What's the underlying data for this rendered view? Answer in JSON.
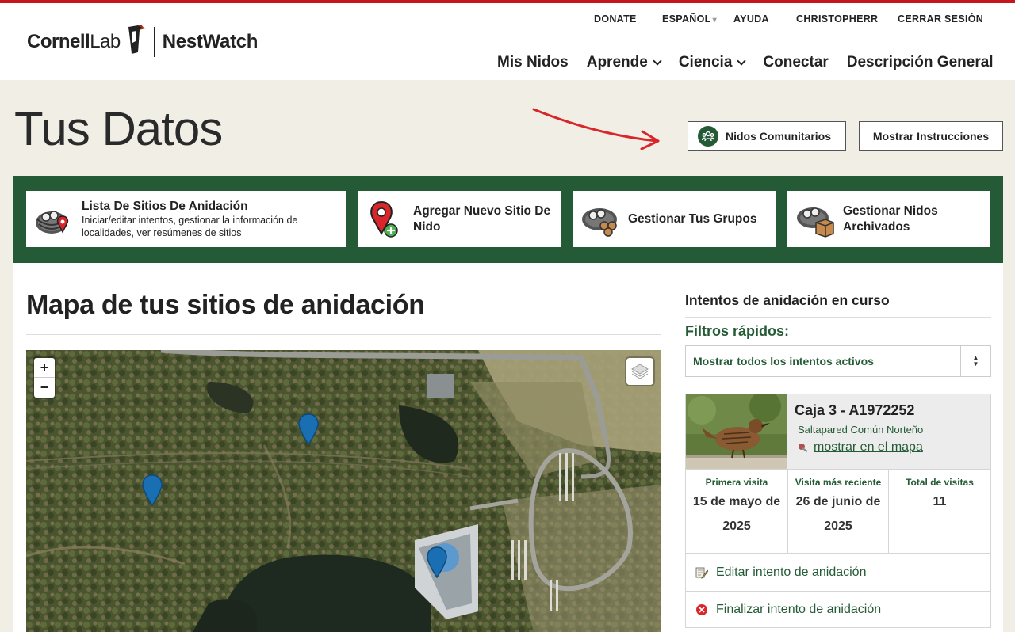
{
  "header": {
    "logo": {
      "brand": "Cornell",
      "brand_suffix": "Lab",
      "product": "NestWatch"
    },
    "utility_nav": {
      "donate": "DONATE",
      "language": "ESPAÑOL",
      "help": "AYUDA",
      "user": "CHRISTOPHERR",
      "logout": "CERRAR SESIÓN"
    },
    "main_nav": {
      "my_nests": "Mis Nidos",
      "learn": "Aprende",
      "science": "Ciencia",
      "connect": "Conectar",
      "overview": "Descripción General"
    }
  },
  "page": {
    "title": "Tus Datos",
    "community_button": "Nidos Comunitarios",
    "instructions_button": "Mostrar Instrucciones"
  },
  "tiles": [
    {
      "title": "Lista De Sitios De Anidación",
      "description": "Iniciar/editar intentos, gestionar la información de localidades, ver resúmenes de sitios"
    },
    {
      "title": "Agregar Nuevo Sitio De Nido"
    },
    {
      "title": "Gestionar Tus Grupos"
    },
    {
      "title": "Gestionar Nidos Archivados"
    }
  ],
  "map_section": {
    "title": "Mapa de tus sitios de anidación",
    "zoom_in": "+",
    "zoom_out": "−"
  },
  "sidebar": {
    "title": "Intentos de anidación en curso",
    "filters_label": "Filtros rápidos:",
    "filter_value": "Mostrar todos los intentos activos",
    "card": {
      "name": "Caja 3 - A1972252",
      "species": "Saltapared Común Norteño",
      "map_link": "mostrar en el mapa",
      "stats": [
        {
          "label": "Primera visita",
          "value_line1": "15 de mayo de",
          "value_line2": "2025"
        },
        {
          "label": "Visita más reciente",
          "value_line1": "26 de junio de",
          "value_line2": "2025"
        },
        {
          "label": "Total de visitas",
          "value_line1": "11",
          "value_line2": ""
        }
      ],
      "edit_action": "Editar intento de anidación",
      "finish_action": "Finalizar intento de anidación"
    }
  },
  "colors": {
    "brand_green": "#245b36",
    "top_bar_red": "#c4161c",
    "page_bg": "#f1eee6"
  }
}
